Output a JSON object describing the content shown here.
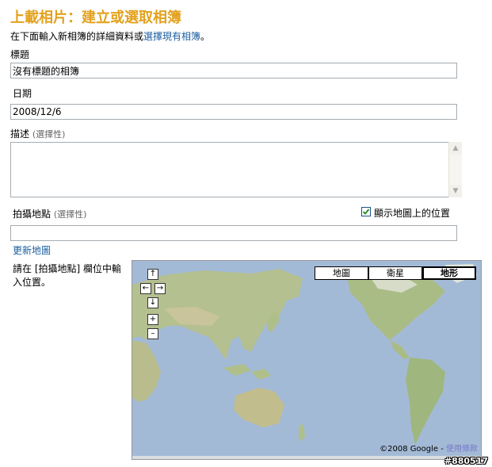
{
  "page": {
    "title": "上載相片：建立或選取相簿",
    "intro_text": "在下面輸入新相簿的詳細資料或",
    "intro_link": "選擇現有相簿",
    "intro_end": "。"
  },
  "form": {
    "title_label": "標題",
    "title_value": "沒有標題的相簿",
    "date_label": "日期",
    "date_value": "2008/12/6",
    "description_label": "描述",
    "description_optional": "(選擇性)",
    "description_value": "",
    "location_label": "拍攝地點",
    "location_optional": "(選擇性)",
    "location_value": "",
    "show_map_checkbox_label": "顯示地圖上的位置",
    "show_map_checked": true,
    "update_map_link": "更新地圖",
    "map_hint": "請在 [拍攝地點] 欄位中輸入位置。"
  },
  "map": {
    "controls": {
      "pan_up": "↑",
      "pan_left": "←",
      "pan_right": "→",
      "pan_down": "↓",
      "zoom_in": "+",
      "zoom_out": "–"
    },
    "types": [
      {
        "label": "地圖",
        "selected": false
      },
      {
        "label": "衛星",
        "selected": false
      },
      {
        "label": "地形",
        "selected": true
      }
    ],
    "copyright": "©2008 Google - ",
    "terms_link": "使用條款"
  },
  "badge": "#880517",
  "colors": {
    "title": "#e3a11d",
    "link": "#1a5d9e",
    "ocean": "#9fb8d6",
    "land": "#b3c190"
  }
}
